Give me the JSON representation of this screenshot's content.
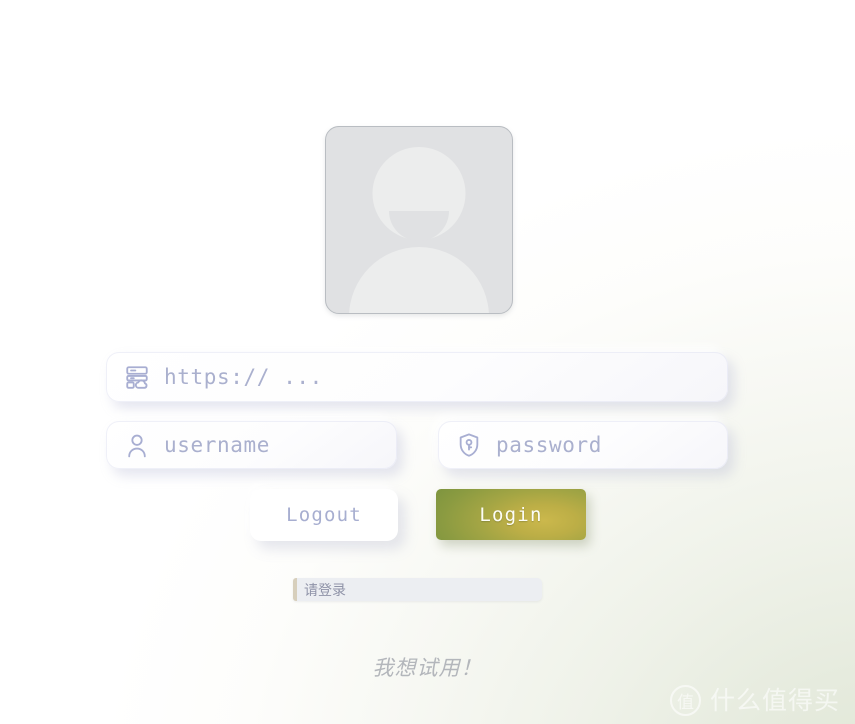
{
  "page": {
    "background_top": "#ffffff",
    "background_bottom_right": "#dfe6d4"
  },
  "avatar": {
    "alt": "default-user-avatar",
    "box_color": "#e0e1e3",
    "figure_color": "#eceded",
    "border_color": "#b9bdc2"
  },
  "form": {
    "url_field": {
      "icon": "server-cloud-icon",
      "value": "",
      "placeholder": "https:// ..."
    },
    "username_field": {
      "icon": "user-icon",
      "value": "",
      "placeholder": "username"
    },
    "password_field": {
      "icon": "shield-key-icon",
      "value": "",
      "placeholder": "password"
    },
    "placeholder_color": "#aab0ce"
  },
  "actions": {
    "logout_label": "Logout",
    "logout_color": "#a7aed0",
    "login_label": "Login",
    "login_gradient_start": "#cbb84c",
    "login_gradient_end": "#68883b"
  },
  "status": {
    "message": "请登录",
    "accent_color": "#d7cfbc",
    "background": "#eceef2"
  },
  "tagline": {
    "text": "我想试用！",
    "color": "#b3b6bb"
  },
  "watermark": {
    "badge": "值",
    "text": "什么值得买",
    "color": "#ffffff"
  }
}
